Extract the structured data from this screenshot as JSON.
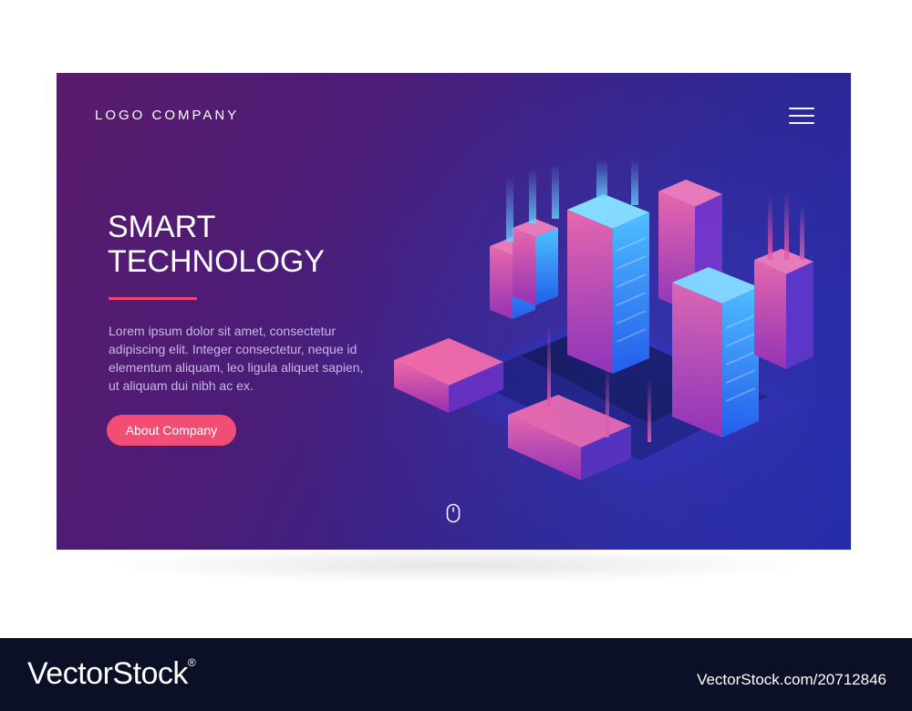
{
  "header": {
    "logo": "LOGO COMPANY",
    "menu_icon": "hamburger-menu-icon"
  },
  "hero": {
    "title_line1": "SMART",
    "title_line2": "TECHNOLOGY",
    "body": "Lorem ipsum dolor sit amet, consectetur adipiscing elit. Integer consectetur, neque id elementum aliquam, leo ligula aliquet sapien, ut aliquam dui nibh ac ex.",
    "cta_label": "About Company",
    "scroll_icon": "mouse-scroll-icon",
    "illustration": "isometric-city-servers"
  },
  "colors": {
    "accent": "#f24d74",
    "bg_start": "#5a1b6b",
    "bg_end": "#2429a3",
    "building_blue": "#2fa8ff",
    "building_pink": "#ff4f86"
  },
  "watermark": {
    "brand": "VectorStock",
    "brand_mark": "®",
    "id_text": "VectorStock.com/20712846"
  }
}
